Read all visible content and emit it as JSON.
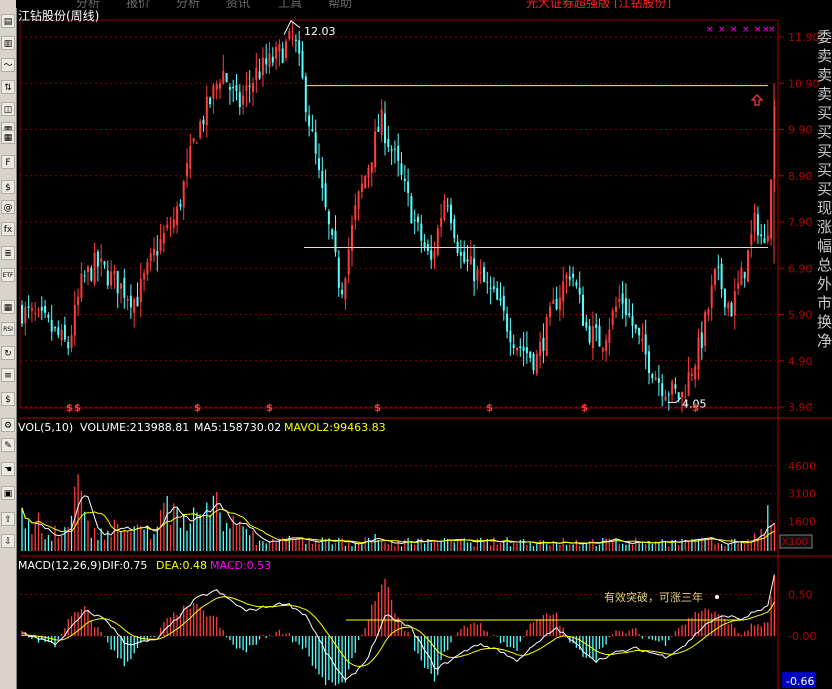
{
  "toolbar": {
    "buttons": [
      {
        "name": "minute-chart-icon",
        "glyph": "▤"
      },
      {
        "name": "kline-icon",
        "glyph": "▥"
      },
      {
        "name": "trend-icon",
        "glyph": "〜"
      },
      {
        "name": "compare-icon",
        "glyph": "⇅"
      },
      {
        "name": "window-icon",
        "glyph": "◫"
      },
      {
        "name": "layout-icon",
        "glyph": "▦"
      },
      {
        "name": "table-icon",
        "glyph": "▦"
      },
      {
        "name": "f10-icon",
        "glyph": "F"
      },
      {
        "name": "info-icon",
        "glyph": "$"
      },
      {
        "name": "alert-icon",
        "glyph": "@"
      },
      {
        "name": "formula-icon",
        "glyph": "fx"
      },
      {
        "name": "list-icon",
        "glyph": "≣"
      },
      {
        "name": "etf-icon",
        "glyph": "ETF"
      },
      {
        "name": "grid-icon",
        "glyph": "▦"
      },
      {
        "name": "rsi-icon",
        "glyph": "RSI"
      },
      {
        "name": "refresh-icon",
        "glyph": "↻"
      },
      {
        "name": "notes-icon",
        "glyph": "≡"
      },
      {
        "name": "dollar-icon",
        "glyph": "$"
      },
      {
        "name": "tool-icon",
        "glyph": "⚙"
      },
      {
        "name": "pencil-icon",
        "glyph": "✎"
      },
      {
        "name": "hand-icon",
        "glyph": "☚"
      },
      {
        "name": "chart-add-icon",
        "glyph": "▣"
      },
      {
        "name": "arrow-up-icon",
        "glyph": "⇧"
      },
      {
        "name": "arrow-down-icon",
        "glyph": "⇩"
      }
    ]
  },
  "top_strip": {
    "ad_text": "光大证券超强版 [江钻股份]"
  },
  "price_panel": {
    "title": "江钻股份(周线)",
    "high_label": "12.03",
    "low_label": "4.05",
    "y_ticks": [
      "11.90",
      "10.90",
      "9.90",
      "8.90",
      "7.90",
      "6.90",
      "5.90",
      "4.90",
      "3.90"
    ],
    "y_values": [
      11.9,
      10.9,
      9.9,
      8.9,
      7.9,
      6.9,
      5.9,
      4.9,
      3.9
    ],
    "marker_glyph": "×",
    "signal_glyph": "$"
  },
  "vol_panel": {
    "title_vol": "VOL(5,10)",
    "vol_text": "VOLUME:213988.81",
    "ma5_text": "MA5:158730.02",
    "mavol2_text": "MAVOL2:99463.83",
    "y_ticks": [
      "4600",
      "3100",
      "1600"
    ],
    "unit_label": "X100"
  },
  "macd_panel": {
    "title": "MACD(12,26,9)",
    "dif_text": "DIF:0.75",
    "dea_text": "DEA:0.48",
    "macd_text": "MACD:0.53",
    "y_ticks": [
      "0.50",
      "-0.00"
    ],
    "bottom_value": "-0.66",
    "annotation": "有效突破，可涨三年"
  },
  "side_text": "委卖卖卖买买买买买现涨幅总外市换净",
  "colors": {
    "up": "#ff3c3c",
    "down": "#54ffff",
    "grid": "#8a0000",
    "axis_text": "#b40000",
    "white": "#ffffff",
    "yellow": "#ffff00",
    "magenta": "#ff00ff",
    "annot": "#e0d080"
  }
}
